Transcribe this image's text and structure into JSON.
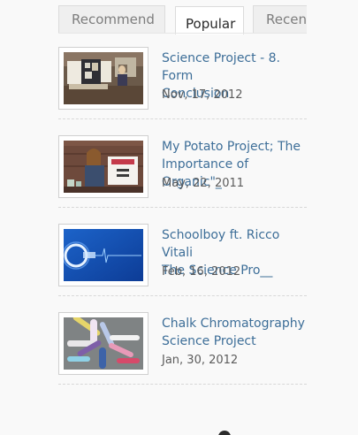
{
  "tabs": [
    {
      "label": "Recommend",
      "active": false
    },
    {
      "label": "Popular",
      "active": true
    },
    {
      "label": "Recent",
      "active": false
    }
  ],
  "posts": [
    {
      "title": "Science Project - 8. Form\nConclusion",
      "date": "Nov, 17, 2012",
      "thumb": "science-fair-display-photo"
    },
    {
      "title": "My Potato Project; The\nImportance of Organic\"_",
      "date": "May, 22, 2011",
      "thumb": "girl-with-poster-photo"
    },
    {
      "title": "Schoolboy ft. Ricco Vitali\nThe Science Pro__",
      "date": "Feb, 16, 2012",
      "thumb": "blue-glow-logo-photo"
    },
    {
      "title": "Chalk Chromatography\nScience Project",
      "date": "Jan, 30, 2012",
      "thumb": "chalk-sticks-photo"
    }
  ],
  "colors": {
    "link": "#3d6e98",
    "date": "#5c5c5c",
    "tab_bg": "#efefef",
    "tab_active_bg": "#ffffff"
  }
}
